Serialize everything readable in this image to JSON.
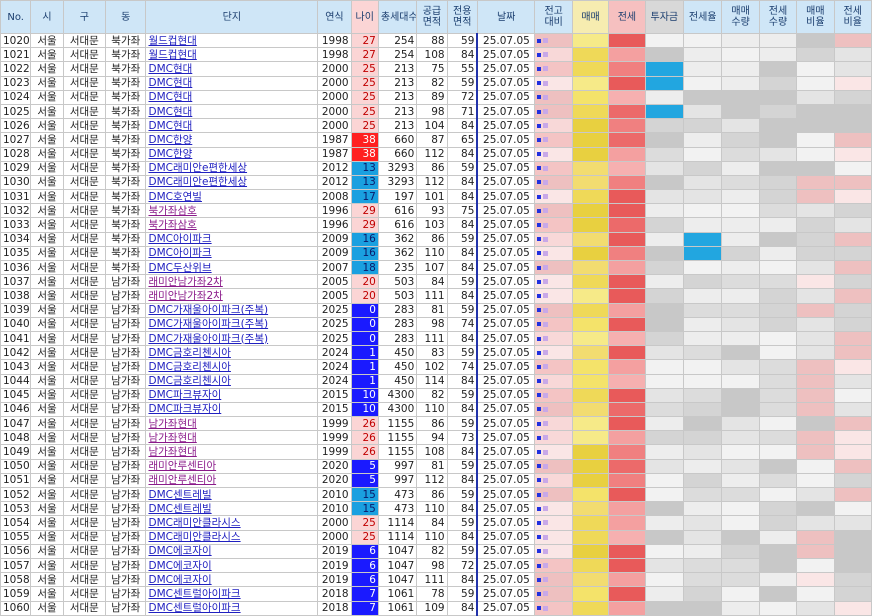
{
  "columns": [
    "No.",
    "시",
    "구",
    "동",
    "단지",
    "연식",
    "나이",
    "총세대수",
    "공급\n면적",
    "전용\n면적",
    "날짜",
    "전고\n대비",
    "매매",
    "전세",
    "투자금",
    "전세율",
    "매매\n수량",
    "전세\n수량",
    "매매\n비율",
    "전세\n비율"
  ],
  "rows": [
    [
      "1020",
      "서울",
      "서대문",
      "북가좌",
      "월드컵현대",
      "1998",
      "27",
      "254",
      "88",
      "59",
      "25.07.05"
    ],
    [
      "1021",
      "서울",
      "서대문",
      "북가좌",
      "월드컵현대",
      "1998",
      "27",
      "254",
      "108",
      "84",
      "25.07.05"
    ],
    [
      "1022",
      "서울",
      "서대문",
      "북가좌",
      "DMC현대",
      "2000",
      "25",
      "213",
      "75",
      "55",
      "25.07.05"
    ],
    [
      "1023",
      "서울",
      "서대문",
      "북가좌",
      "DMC현대",
      "2000",
      "25",
      "213",
      "82",
      "59",
      "25.07.05"
    ],
    [
      "1024",
      "서울",
      "서대문",
      "북가좌",
      "DMC현대",
      "2000",
      "25",
      "213",
      "89",
      "72",
      "25.07.05"
    ],
    [
      "1025",
      "서울",
      "서대문",
      "북가좌",
      "DMC현대",
      "2000",
      "25",
      "213",
      "98",
      "71",
      "25.07.05"
    ],
    [
      "1026",
      "서울",
      "서대문",
      "북가좌",
      "DMC현대",
      "2000",
      "25",
      "213",
      "104",
      "84",
      "25.07.05"
    ],
    [
      "1027",
      "서울",
      "서대문",
      "북가좌",
      "DMC한양",
      "1987",
      "38",
      "660",
      "87",
      "65",
      "25.07.05"
    ],
    [
      "1028",
      "서울",
      "서대문",
      "북가좌",
      "DMC한양",
      "1987",
      "38",
      "660",
      "112",
      "84",
      "25.07.05"
    ],
    [
      "1029",
      "서울",
      "서대문",
      "북가좌",
      "DMC래미안e편한세상",
      "2012",
      "13",
      "3293",
      "86",
      "59",
      "25.07.05"
    ],
    [
      "1030",
      "서울",
      "서대문",
      "북가좌",
      "DMC래미안e편한세상",
      "2012",
      "13",
      "3293",
      "112",
      "84",
      "25.07.05"
    ],
    [
      "1031",
      "서울",
      "서대문",
      "북가좌",
      "DMC호연빌",
      "2008",
      "17",
      "197",
      "101",
      "84",
      "25.07.05"
    ],
    [
      "1032",
      "서울",
      "서대문",
      "북가좌",
      "북가좌삼호",
      "1996",
      "29",
      "616",
      "93",
      "75",
      "25.07.05"
    ],
    [
      "1033",
      "서울",
      "서대문",
      "북가좌",
      "북가좌삼호",
      "1996",
      "29",
      "616",
      "103",
      "84",
      "25.07.05"
    ],
    [
      "1034",
      "서울",
      "서대문",
      "북가좌",
      "DMC아이파크",
      "2009",
      "16",
      "362",
      "86",
      "59",
      "25.07.05"
    ],
    [
      "1035",
      "서울",
      "서대문",
      "북가좌",
      "DMC아이파크",
      "2009",
      "16",
      "362",
      "110",
      "84",
      "25.07.05"
    ],
    [
      "1036",
      "서울",
      "서대문",
      "북가좌",
      "DMC두산위브",
      "2007",
      "18",
      "235",
      "107",
      "84",
      "25.07.05"
    ],
    [
      "1037",
      "서울",
      "서대문",
      "남가좌",
      "래미안남가좌2차",
      "2005",
      "20",
      "503",
      "84",
      "59",
      "25.07.05"
    ],
    [
      "1038",
      "서울",
      "서대문",
      "남가좌",
      "래미안남가좌2차",
      "2005",
      "20",
      "503",
      "111",
      "84",
      "25.07.05"
    ],
    [
      "1039",
      "서울",
      "서대문",
      "남가좌",
      "DMC가재울아이파크(주복)",
      "2025",
      "0",
      "283",
      "81",
      "59",
      "25.07.05"
    ],
    [
      "1040",
      "서울",
      "서대문",
      "남가좌",
      "DMC가재울아이파크(주복)",
      "2025",
      "0",
      "283",
      "98",
      "74",
      "25.07.05"
    ],
    [
      "1041",
      "서울",
      "서대문",
      "남가좌",
      "DMC가재울아이파크(주복)",
      "2025",
      "0",
      "283",
      "111",
      "84",
      "25.07.05"
    ],
    [
      "1042",
      "서울",
      "서대문",
      "남가좌",
      "DMC금호리첸시아",
      "2024",
      "1",
      "450",
      "83",
      "59",
      "25.07.05"
    ],
    [
      "1043",
      "서울",
      "서대문",
      "남가좌",
      "DMC금호리첸시아",
      "2024",
      "1",
      "450",
      "102",
      "74",
      "25.07.05"
    ],
    [
      "1044",
      "서울",
      "서대문",
      "남가좌",
      "DMC금호리첸시아",
      "2024",
      "1",
      "450",
      "114",
      "84",
      "25.07.05"
    ],
    [
      "1045",
      "서울",
      "서대문",
      "남가좌",
      "DMC파크뷰자이",
      "2015",
      "10",
      "4300",
      "82",
      "59",
      "25.07.05"
    ],
    [
      "1046",
      "서울",
      "서대문",
      "남가좌",
      "DMC파크뷰자이",
      "2015",
      "10",
      "4300",
      "110",
      "84",
      "25.07.05"
    ],
    [
      "1047",
      "서울",
      "서대문",
      "남가좌",
      "남가좌현대",
      "1999",
      "26",
      "1155",
      "86",
      "59",
      "25.07.05"
    ],
    [
      "1048",
      "서울",
      "서대문",
      "남가좌",
      "남가좌현대",
      "1999",
      "26",
      "1155",
      "94",
      "73",
      "25.07.05"
    ],
    [
      "1049",
      "서울",
      "서대문",
      "남가좌",
      "남가좌현대",
      "1999",
      "26",
      "1155",
      "108",
      "84",
      "25.07.05"
    ],
    [
      "1050",
      "서울",
      "서대문",
      "남가좌",
      "래미안루센티아",
      "2020",
      "5",
      "997",
      "81",
      "59",
      "25.07.05"
    ],
    [
      "1051",
      "서울",
      "서대문",
      "남가좌",
      "래미안루센티아",
      "2020",
      "5",
      "997",
      "112",
      "84",
      "25.07.05"
    ],
    [
      "1052",
      "서울",
      "서대문",
      "남가좌",
      "DMC센트레빌",
      "2010",
      "15",
      "473",
      "86",
      "59",
      "25.07.05"
    ],
    [
      "1053",
      "서울",
      "서대문",
      "남가좌",
      "DMC센트레빌",
      "2010",
      "15",
      "473",
      "110",
      "84",
      "25.07.05"
    ],
    [
      "1054",
      "서울",
      "서대문",
      "남가좌",
      "DMC래미안클라시스",
      "2000",
      "25",
      "1114",
      "84",
      "59",
      "25.07.05"
    ],
    [
      "1055",
      "서울",
      "서대문",
      "남가좌",
      "DMC래미안클라시스",
      "2000",
      "25",
      "1114",
      "110",
      "84",
      "25.07.05"
    ],
    [
      "1056",
      "서울",
      "서대문",
      "남가좌",
      "DMC에코자이",
      "2019",
      "6",
      "1047",
      "82",
      "59",
      "25.07.05"
    ],
    [
      "1057",
      "서울",
      "서대문",
      "남가좌",
      "DMC에코자이",
      "2019",
      "6",
      "1047",
      "98",
      "72",
      "25.07.05"
    ],
    [
      "1058",
      "서울",
      "서대문",
      "남가좌",
      "DMC에코자이",
      "2019",
      "6",
      "1047",
      "111",
      "84",
      "25.07.05"
    ],
    [
      "1059",
      "서울",
      "서대문",
      "남가좌",
      "DMC센트럴아이파크",
      "2018",
      "7",
      "1061",
      "78",
      "59",
      "25.07.05"
    ],
    [
      "1060",
      "서울",
      "서대문",
      "남가좌",
      "DMC센트럴아이파크",
      "2018",
      "7",
      "1061",
      "109",
      "84",
      "25.07.05"
    ]
  ],
  "colors": {
    "header_bg": "#cfe6f7",
    "age_high": "#ff2020",
    "age_blue": "#1a1aff",
    "age_cyan": "#1aa0e0",
    "age_pink": "#fbd5d5",
    "sale_yellow": "#f4e36a",
    "jeonse_red": "#f08080",
    "invest_blue": "#22a6e0",
    "link_text": "#2020c0"
  }
}
